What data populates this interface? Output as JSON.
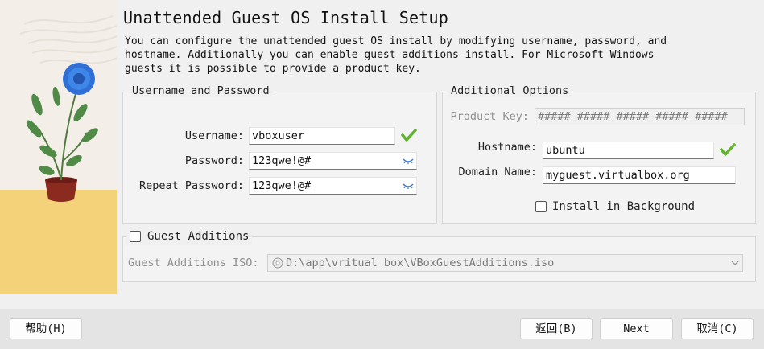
{
  "title": "Unattended Guest OS Install Setup",
  "description": "You can configure the unattended guest OS install by modifying username, password, and hostname. Additionally you can enable guest additions install. For Microsoft Windows guests it is possible to provide a product key.",
  "user_group": {
    "label": "Username and Password",
    "username_label": "Username:",
    "username_value": "vboxuser",
    "password_label": "Password:",
    "password_value": "123qwe!@#",
    "repeat_label": "Repeat Password:",
    "repeat_value": "123qwe!@#"
  },
  "options_group": {
    "label": "Additional Options",
    "product_key_label": "Product Key:",
    "product_key_value": "#####-#####-#####-#####-#####",
    "hostname_label": "Hostname:",
    "hostname_value": "ubuntu",
    "domain_label": "Domain Name:",
    "domain_value": "myguest.virtualbox.org",
    "install_bg_label": "Install in Background",
    "install_bg_checked": false
  },
  "guest_additions": {
    "label": "Guest Additions",
    "checked": false,
    "iso_label": "Guest Additions ISO:",
    "iso_value": "D:\\app\\vritual box\\VBoxGuestAdditions.iso"
  },
  "buttons": {
    "help": "帮助(H)",
    "back": "返回(B)",
    "next": "Next",
    "cancel": "取消(C)"
  },
  "icons": {
    "valid": "green-check-icon",
    "reveal": "eye-icon",
    "disc": "disc-icon",
    "dropdown": "chevron-down-icon"
  },
  "colors": {
    "valid_green": "#5fb32e",
    "eye_blue": "#3a7bd5"
  }
}
